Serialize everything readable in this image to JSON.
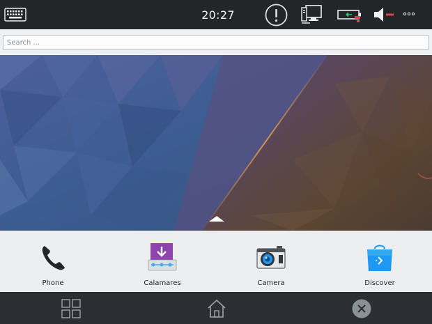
{
  "status_bar": {
    "time": "20:27",
    "icons": [
      "keyboard-icon",
      "notification-icon",
      "network-icon",
      "battery-icon",
      "volume-muted-icon",
      "more-icon"
    ]
  },
  "search": {
    "placeholder": "Search ...",
    "value": ""
  },
  "dock": {
    "apps": [
      {
        "label": "Phone",
        "icon": "phone-icon"
      },
      {
        "label": "Calamares",
        "icon": "calamares-icon"
      },
      {
        "label": "Camera",
        "icon": "camera-icon"
      },
      {
        "label": "Discover",
        "icon": "discover-icon"
      }
    ]
  },
  "navbar": {
    "buttons": [
      "app-grid-icon",
      "home-icon",
      "close-icon"
    ]
  },
  "colors": {
    "topbar": "#232629",
    "dock": "#eceeef",
    "navbar": "#2b2f33",
    "calamares_accent": "#8e44ad",
    "discover_accent": "#1d99f3",
    "muted_red": "#da4453"
  }
}
